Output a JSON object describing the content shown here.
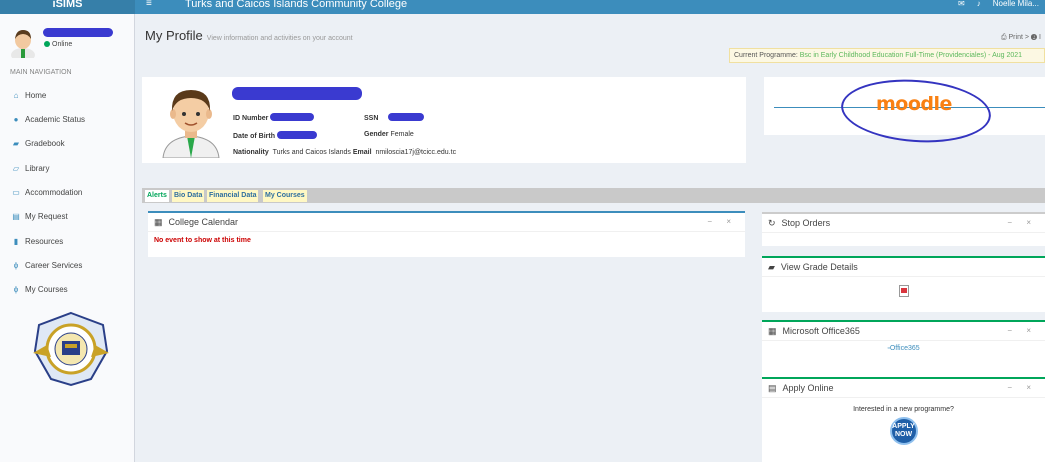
{
  "topbar": {
    "brand": "iSIMS",
    "menu_toggle": "≡",
    "school_name": "Turks and Caicos Islands Community College",
    "right_text": "Noelle Mila..."
  },
  "sidebar": {
    "status": "Online",
    "nav_header": "MAIN NAVIGATION",
    "items": [
      {
        "label": "Home",
        "icon": "home-icon"
      },
      {
        "label": "Academic Status",
        "icon": "info-icon"
      },
      {
        "label": "Gradebook",
        "icon": "graduation-cap-icon"
      },
      {
        "label": "Library",
        "icon": "book-icon"
      },
      {
        "label": "Accommodation",
        "icon": "bed-icon"
      },
      {
        "label": "My Request",
        "icon": "inbox-icon"
      },
      {
        "label": "Resources",
        "icon": "file-icon"
      },
      {
        "label": "Career Services",
        "icon": "pin-icon"
      },
      {
        "label": "My Courses",
        "icon": "pin-icon"
      }
    ]
  },
  "header": {
    "title": "My Profile",
    "subtitle": "View information and activities on your account",
    "print": "⎙ Print",
    "help": "❷ I",
    "programme_label": "Current Programme:",
    "programme_value": "Bsc in Early Childhood Education Full-Time (Providenciales) - Aug 2021"
  },
  "profile": {
    "id_label": "ID Number",
    "ssn_label": "SSN",
    "dob_label": "Date of Birth",
    "gender_label": "Gender",
    "gender_value": "Female",
    "nationality_label": "Nationality",
    "nationality_value": "Turks and Caicos Islands",
    "email_label": "Email",
    "email_value": "nmiloscia17j@tcicc.edu.tc"
  },
  "moodle": {
    "logo_text": "moodle"
  },
  "tabs": [
    {
      "label": "Alerts",
      "active": true
    },
    {
      "label": "Bio Data",
      "active": false
    },
    {
      "label": "Financial Data",
      "active": false
    },
    {
      "label": "My Courses",
      "active": false
    }
  ],
  "calendar": {
    "title": "College Calendar",
    "empty_msg": "No event to show at this time",
    "tools": "− ×"
  },
  "widgets": {
    "stop_orders": {
      "title": "Stop Orders",
      "tools": "− ×"
    },
    "grades": {
      "title": "View Grade Details"
    },
    "office": {
      "title": "Microsoft Office365",
      "img_alt": "Office365",
      "tools": "− ×"
    },
    "apply": {
      "title": "Apply Online",
      "text": "Interested in a new programme?",
      "button": "APPLY NOW",
      "tools": "− ×"
    }
  },
  "colors": {
    "topbar": "#3c8dbc",
    "accent_green": "#00a65a",
    "annotation": "#3434c0",
    "moodle_orange": "#f98012"
  }
}
